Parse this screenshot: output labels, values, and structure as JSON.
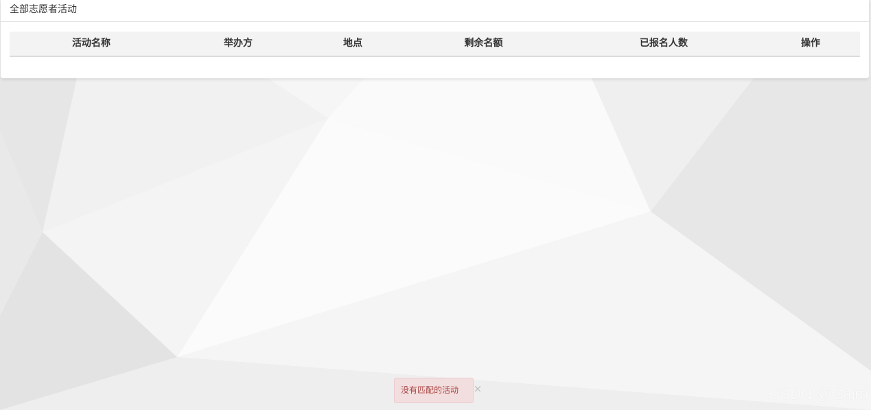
{
  "panel": {
    "title": "全部志愿者活动"
  },
  "table": {
    "columns": [
      "活动名称",
      "举办方",
      "地点",
      "剩余名额",
      "已报名人数",
      "操作"
    ],
    "rows": []
  },
  "alert": {
    "message": "没有匹配的活动",
    "close_symbol": "×"
  },
  "watermark": "CSDN @Gairo",
  "colors": {
    "alert_bg": "#f2dede",
    "alert_text": "#a94442",
    "header_bg": "#f3f3f3",
    "page_bg": "#ececec"
  }
}
